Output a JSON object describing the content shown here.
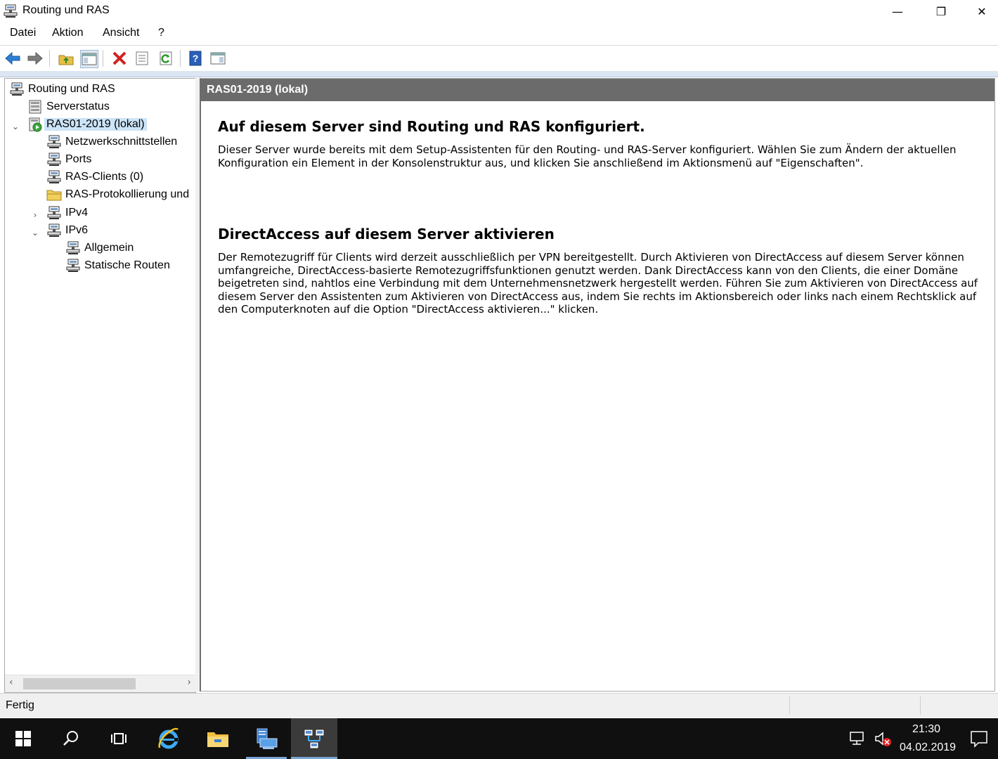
{
  "window": {
    "title": "Routing und RAS",
    "controls": {
      "minimize": "—",
      "restore": "❐",
      "close": "✕"
    }
  },
  "menu": {
    "items": [
      "Datei",
      "Aktion",
      "Ansicht",
      "?"
    ]
  },
  "toolbar": {
    "buttons": [
      "back-icon",
      "forward-icon",
      "up-folder-icon",
      "show-hide-tree-icon",
      "delete-icon",
      "properties-icon",
      "refresh-icon",
      "help-icon",
      "action-pane-icon"
    ]
  },
  "tree": {
    "root": "Routing und RAS",
    "items": [
      {
        "label": "Serverstatus",
        "icon": "server-status-icon"
      },
      {
        "label": "RAS01-2019 (lokal)",
        "icon": "server-running-icon",
        "selected": true,
        "expanded": true
      },
      {
        "label": "Netzwerkschnittstellen",
        "icon": "network-interfaces-icon"
      },
      {
        "label": "Ports",
        "icon": "ports-icon"
      },
      {
        "label": "RAS-Clients (0)",
        "icon": "ras-clients-icon"
      },
      {
        "label": "RAS-Protokollierung und",
        "icon": "folder-icon"
      },
      {
        "label": "IPv4",
        "icon": "ipv4-icon",
        "expanded": false
      },
      {
        "label": "IPv6",
        "icon": "ipv6-icon",
        "expanded": true
      },
      {
        "label": "Allgemein",
        "icon": "general-icon"
      },
      {
        "label": "Statische Routen",
        "icon": "static-routes-icon"
      }
    ]
  },
  "content": {
    "header": "RAS01-2019 (lokal)",
    "sections": [
      {
        "heading": "Auf diesem Server sind Routing und RAS konfiguriert.",
        "text": "Dieser Server wurde bereits mit dem Setup-Assistenten für den Routing- und RAS-Server konfiguriert. Wählen Sie zum Ändern der aktuellen Konfiguration ein Element in der Konsolenstruktur aus, und klicken Sie anschließend im Aktionsmenü auf \"Eigenschaften\"."
      },
      {
        "heading": "DirectAccess auf diesem Server aktivieren",
        "text": "Der Remotezugriff für Clients wird derzeit ausschließlich per VPN bereitgestellt. Durch Aktivieren von DirectAccess auf diesem Server können umfangreiche, DirectAccess-basierte Remotezugriffsfunktionen genutzt werden. Dank DirectAccess kann von den Clients, die einer Domäne beigetreten sind, nahtlos eine Verbindung mit dem Unternehmensnetzwerk hergestellt werden. Führen Sie zum Aktivieren von DirectAccess auf diesem Server den Assistenten zum Aktivieren von DirectAccess aus, indem Sie rechts im Aktionsbereich oder links nach einem Rechtsklick auf den Computerknoten auf die Option \"DirectAccess aktivieren...\" klicken."
      }
    ]
  },
  "status": {
    "text": "Fertig"
  },
  "taskbar": {
    "time": "21:30",
    "date": "04.02.2019"
  }
}
